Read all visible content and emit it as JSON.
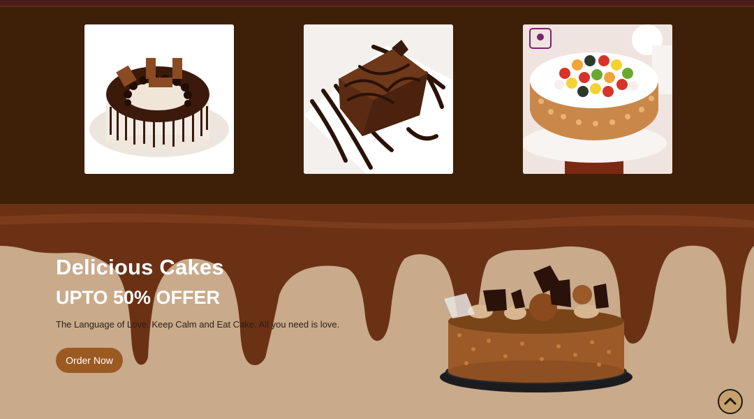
{
  "gallery": {
    "images": [
      {
        "icon": "chocolate-drip-cake-image"
      },
      {
        "icon": "brownie-slice-image"
      },
      {
        "icon": "fruit-cake-image"
      }
    ]
  },
  "hero": {
    "title": "Delicious Cakes",
    "offer": "UPTO 50% OFFER",
    "tagline": "The Language of Love. Keep Calm and Eat Cake. All you need is love.",
    "button_label": "Order Now",
    "cake_icon": "chocolate-truffle-cake-image"
  },
  "scroll_top": {
    "icon": "chevron-up-icon"
  },
  "colors": {
    "gallery_bg": "#3e1f07",
    "hero_bg": "#c8a888",
    "chocolate": "#6b3115",
    "button": "#9a5a22"
  }
}
